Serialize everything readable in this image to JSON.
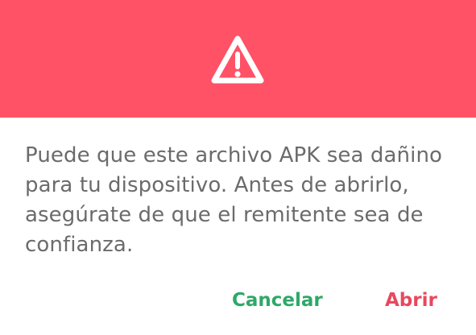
{
  "dialog": {
    "header_color": "#ff5266",
    "icon": "warning-triangle-icon",
    "message": "Puede que este archivo APK sea dañino para tu dispositivo. Antes de abrirlo, asegúrate de que el remitente sea de confianza.",
    "actions": {
      "cancel_label": "Cancelar",
      "cancel_color": "#2ea868",
      "open_label": "Abrir",
      "open_color": "#e8485e"
    }
  }
}
